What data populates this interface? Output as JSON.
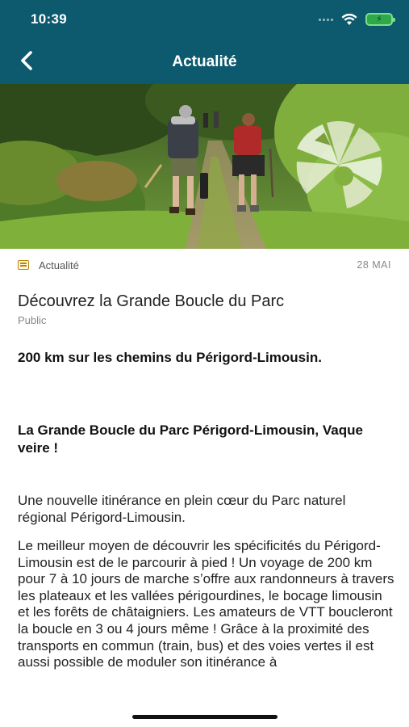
{
  "status_bar": {
    "time": "10:39",
    "signal_icon": "signal-icon",
    "wifi_icon": "wifi-icon",
    "battery_icon": "battery-charging-icon"
  },
  "nav": {
    "title": "Actualité",
    "back_icon": "chevron-left-icon"
  },
  "hero": {
    "description_icon": "hero-photo",
    "logo_icon": "park-logo-icon"
  },
  "article": {
    "category": "Actualité",
    "category_icon": "newspaper-icon",
    "date": "28 MAI",
    "title": "Découvrez la Grande Boucle du Parc",
    "audience": "Public",
    "subtitle1": "200 km sur les chemins du Périgord-Limousin.",
    "subtitle2": "La Grande Boucle du Parc Périgord-Limousin, Vaque veire !",
    "paragraph1": "Une nouvelle itinérance en plein cœur du Parc naturel régional Périgord-Limousin.",
    "paragraph2": "Le meilleur moyen de découvrir les spécificités du Périgord-Limousin est de le parcourir à pied ! Un voyage de 200 km pour 7 à 10 jours de marche s’offre aux randonneurs à travers les plateaux et les vallées périgourdines, le bocage limousin et les forêts de châtaigniers. Les amateurs de VTT boucleront la boucle en 3 ou 4 jours même ! Grâce à la proximité des transports en commun (train, bus) et des voies vertes il est aussi possible de moduler son itinérance à"
  },
  "colors": {
    "header_bg": "#0d5a6e",
    "header_text": "#ffffff",
    "accent_icon": "#b8860b"
  }
}
